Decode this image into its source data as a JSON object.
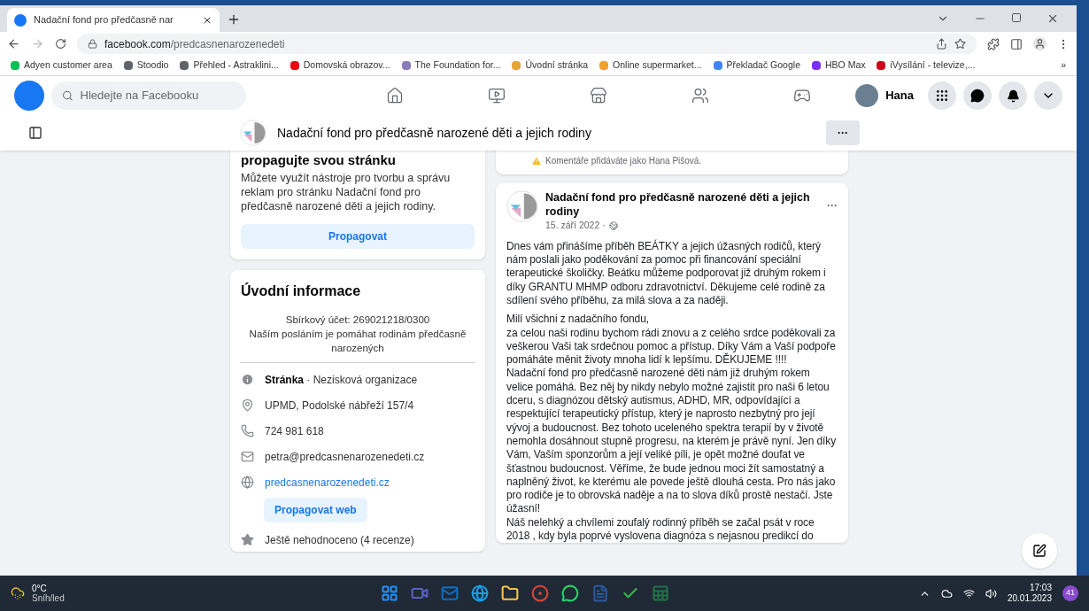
{
  "browser": {
    "tab_title": "Nadační fond pro předčasně nar",
    "url_host": "facebook.com",
    "url_path": "/predcasnenarozenedeti",
    "bookmarks": [
      {
        "label": "Adyen customer area",
        "color": "#0abf53"
      },
      {
        "label": "Stoodio",
        "color": "#5f6368"
      },
      {
        "label": "Přehled - Astraklini...",
        "color": "#5f6368"
      },
      {
        "label": "Domovská obrazov...",
        "color": "#e50914"
      },
      {
        "label": "The Foundation for...",
        "color": "#8a7bbd"
      },
      {
        "label": "Úvodní stránka",
        "color": "#e6a53a"
      },
      {
        "label": "Online supermarket...",
        "color": "#f0a030"
      },
      {
        "label": "Překladač Google",
        "color": "#4285f4"
      },
      {
        "label": "HBO Max",
        "color": "#7b2ff7"
      },
      {
        "label": "iVysílání - televize,...",
        "color": "#d0021b"
      }
    ],
    "more_bookmarks": "»"
  },
  "facebook": {
    "search_placeholder": "Hledejte na Facebooku",
    "user_name": "Hana",
    "nav": [
      {
        "kind": "home",
        "selected": false
      },
      {
        "kind": "video",
        "selected": false
      },
      {
        "kind": "market",
        "selected": false
      },
      {
        "kind": "groups",
        "selected": false
      },
      {
        "kind": "gaming",
        "selected": false
      }
    ]
  },
  "page_bar": {
    "title": "Nadační fond pro předčasně narozené děti a jejich rodiny",
    "more": "···"
  },
  "promo": {
    "heading": "propagujte svou stránku",
    "text": "Můžete využít nástroje pro tvorbu a správu reklam pro stránku Nadační fond pro předčasně narozené děti a jejich rodiny.",
    "button": "Propagovat"
  },
  "intro": {
    "heading": "Úvodní informace",
    "bio": [
      "Sbírkový účet: 269021218/0300",
      "Naším posláním je pomáhat rodinám předčasně narozených"
    ],
    "items": [
      {
        "kind": "info",
        "bold": "Stránka",
        "text": " · Nezisková organizace"
      },
      {
        "kind": "address",
        "text": "UPMD, Podolské nábřeží 157/4"
      },
      {
        "kind": "phone",
        "text": "724 981 618"
      },
      {
        "kind": "email",
        "text": "petra@predcasnenarozenedeti.cz"
      },
      {
        "kind": "web",
        "text": "predcasnenarozenedeti.cz",
        "button": "Propagovat web"
      },
      {
        "kind": "rating",
        "text": "Ještě nehodnoceno (4 recenze)"
      }
    ]
  },
  "comment_note": "Komentáře přidáváte jako Hana Pišová.",
  "post": {
    "author": "Nadační fond pro předčasně narozené děti a jejich rodiny",
    "date": "15. září 2022 ·",
    "more": "···",
    "paragraphs": [
      "Dnes vám přinášíme příběh BEÁTKY a jejich úžasných rodičů, který nám poslali jako poděkování za pomoc při financování speciální terapeutické školičky. Beátku můžeme podporovat již druhým rokem i díky GRANTU MHMP odboru zdravotnictví. Děkujeme celé rodině za sdílení svého příběhu, za milá slova a za naději.",
      "Milí všichni z nadačního fondu,\nza celou naši rodinu bychom rádi znovu a z celého srdce poděkovali za veškerou Vaši tak srdečnou pomoc a přístup. Díky Vám a Vaší podpoře pomáháte měnit životy mnoha lidí k lepšímu. DĚKUJEME !!!!\nNadační fond pro předčasně narozené děti nám již druhým rokem velice pomáhá. Bez něj by nikdy nebylo možné zajistit pro naši 6 letou dceru, s diagnózou dětský autismus, ADHD, MR, odpovídající a respektující terapeutický přístup, který je naprosto nezbytný pro její vývoj a budoucnost. Bez tohoto uceleného spektra terapií by v životě nemohla dosáhnout stupně progresu, na kterém je právě nyní. Jen díky Vám, Vaším sponzorům a její veliké píli, je opět možné doufat ve šťastnou budoucnost. Věříme, že bude jednou moci žít samostatný a naplněný život, ke kterému ale povede ještě dlouhá cesta. Pro nás jako pro rodiče je to obrovská naděje a na to slova díků prostě nestačí. Jste úžasní!\nNáš nelehký a chvílemi zoufalý rodinný příběh se začal psát v roce 2018 , kdy byla poprvé vyslovena diagnóza s nejasnou predikcí do"
    ]
  },
  "taskbar": {
    "temperature": "0°C",
    "weather": "Sníh/led",
    "time": "17:03",
    "date": "20.01.2023",
    "badge": "41",
    "apps": [
      {
        "kind": "start",
        "color": "#1e90ff"
      },
      {
        "kind": "chat",
        "color": "#5b5fc7"
      },
      {
        "kind": "outlook",
        "color": "#0f6cbd"
      },
      {
        "kind": "edge",
        "color": "#1b9de2"
      },
      {
        "kind": "folder",
        "color": "#f8c444"
      },
      {
        "kind": "chrome",
        "color": "#db4437"
      },
      {
        "kind": "whatsapp",
        "color": "#25d366"
      },
      {
        "kind": "word",
        "color": "#2b579a"
      },
      {
        "kind": "check",
        "color": "#3bb54a"
      },
      {
        "kind": "excel",
        "color": "#217346"
      }
    ]
  }
}
